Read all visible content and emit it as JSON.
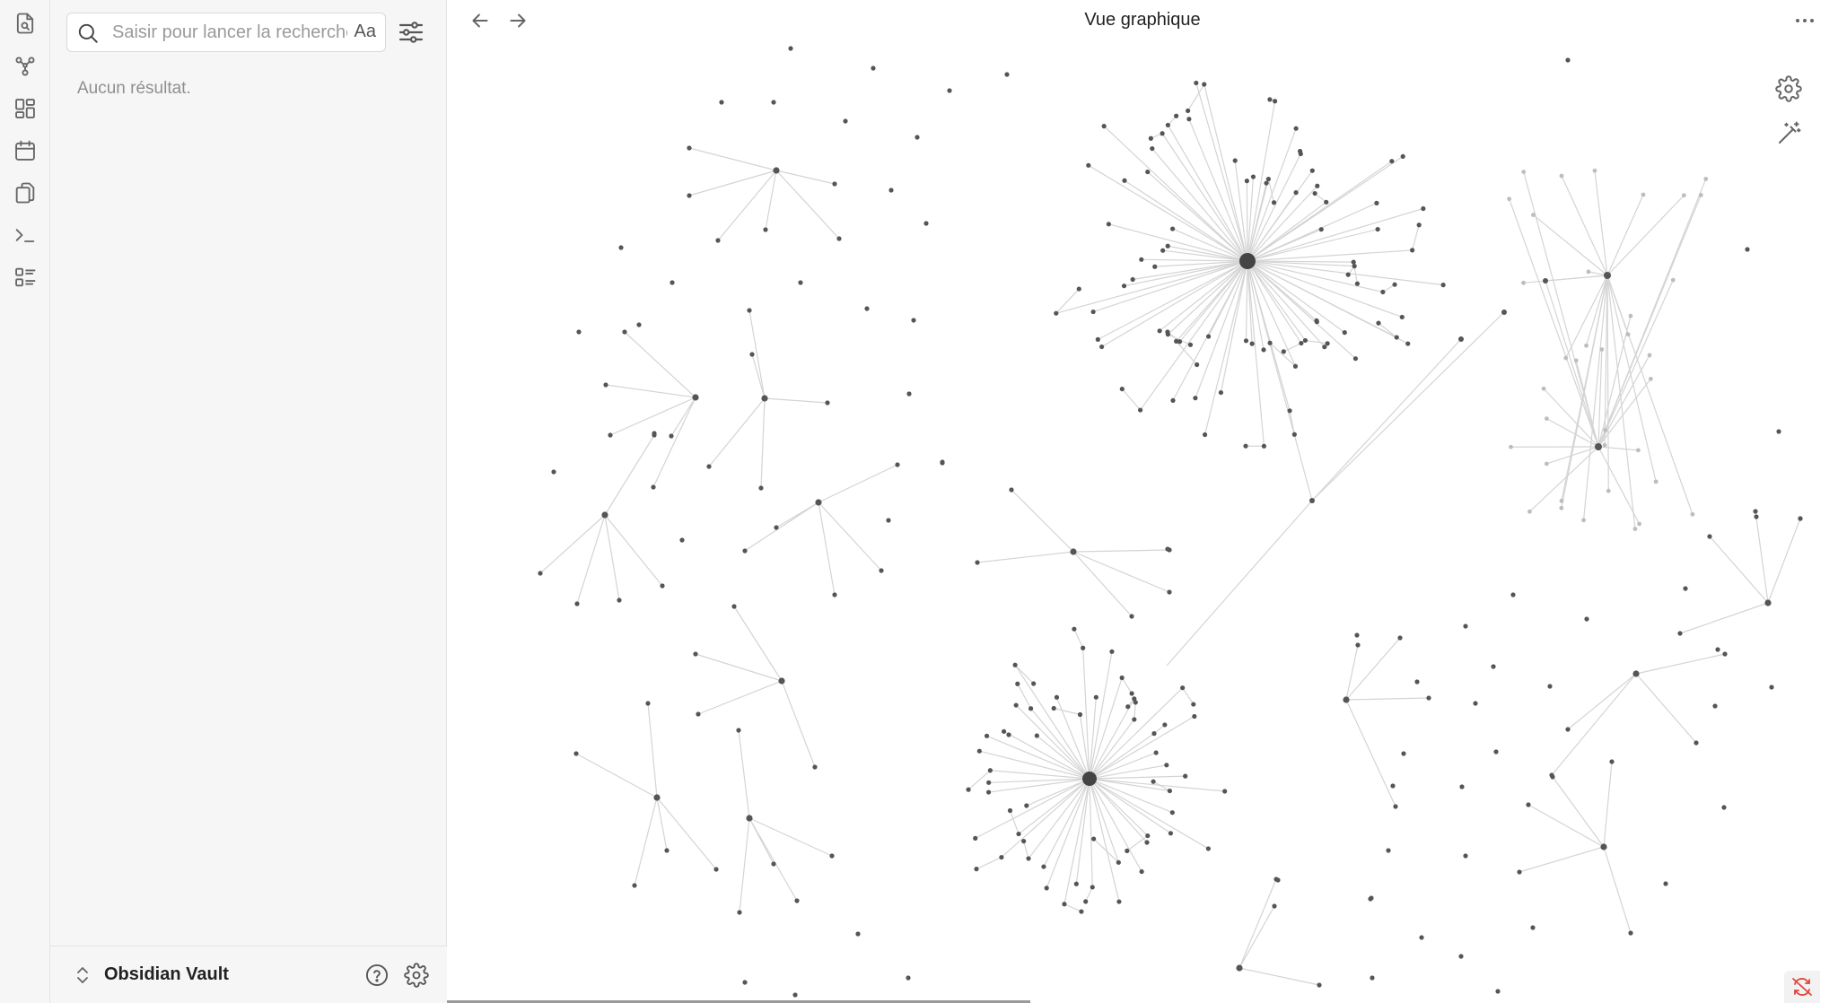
{
  "ribbon": {
    "icons": [
      "file-search-icon",
      "graph-icon",
      "canvas-icon",
      "calendar-icon",
      "copy-icon",
      "terminal-icon",
      "list-icon"
    ]
  },
  "sidebar": {
    "search": {
      "placeholder": "Saisir pour lancer la recherche...",
      "value": "",
      "match_case_label": "Aa"
    },
    "no_results": "Aucun résultat.",
    "vault_name": "Obsidian Vault"
  },
  "main": {
    "title": "Vue graphique"
  },
  "graph": {
    "node_color": "#555555",
    "hub_color": "#444444",
    "faded_color": "#bdbdbd",
    "edge_color": "#d4d4d4"
  },
  "colors": {
    "sync_error": "#e0453a"
  }
}
